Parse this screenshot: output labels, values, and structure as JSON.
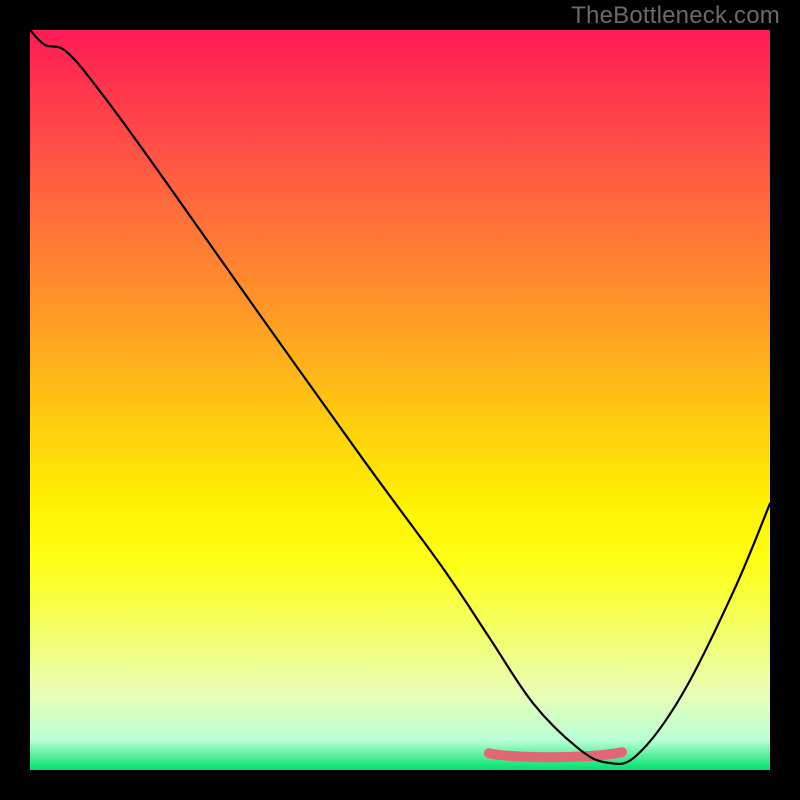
{
  "watermark": "TheBottleneck.com",
  "chart_data": {
    "type": "line",
    "title": "",
    "xlabel": "",
    "ylabel": "",
    "xlim": [
      0,
      100
    ],
    "ylim": [
      0,
      100
    ],
    "background_gradient": {
      "direction": "vertical",
      "stops": [
        {
          "pos": 0.0,
          "color": "#ff1a56"
        },
        {
          "pos": 0.14,
          "color": "#ff4948"
        },
        {
          "pos": 0.34,
          "color": "#ff8b2d"
        },
        {
          "pos": 0.54,
          "color": "#ffd00e"
        },
        {
          "pos": 0.72,
          "color": "#feff16"
        },
        {
          "pos": 0.9,
          "color": "#e8ffb8"
        },
        {
          "pos": 1.0,
          "color": "#00e06a"
        }
      ]
    },
    "series": [
      {
        "name": "bottleneck-curve",
        "x": [
          0,
          2,
          5,
          10,
          18,
          30,
          45,
          56,
          62,
          68,
          74,
          78,
          82,
          88,
          95,
          100
        ],
        "values": [
          100,
          98,
          97,
          91,
          80,
          63,
          42,
          27,
          18,
          9,
          3,
          1,
          2,
          10,
          24,
          36
        ]
      }
    ],
    "highlight_min_range": {
      "x_start": 62,
      "x_end": 80,
      "y": 2
    },
    "annotations": []
  }
}
